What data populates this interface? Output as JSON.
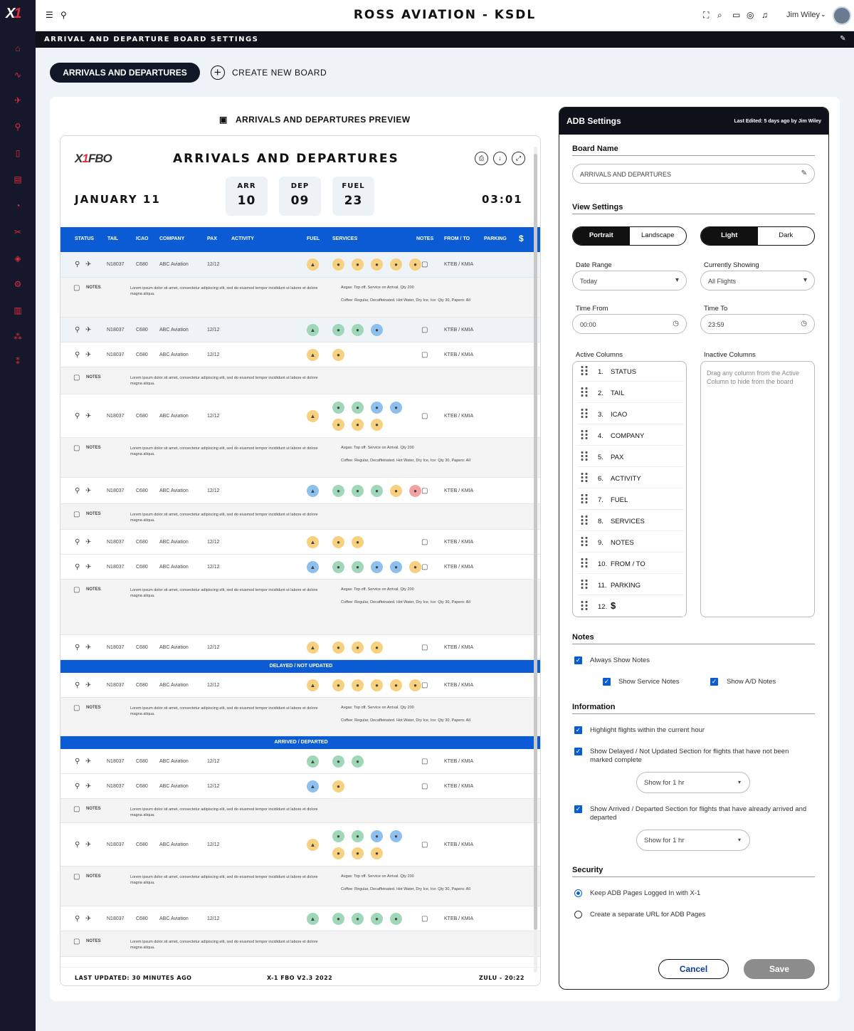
{
  "app": {
    "title": "ROSS AVIATION - KSDL",
    "user": "Jim Wiley",
    "page_title": "ARRIVAL AND DEPARTURE BOARD SETTINGS"
  },
  "actions": {
    "active_board": "ARRIVALS AND DEPARTURES",
    "create_new": "CREATE NEW BOARD"
  },
  "preview": {
    "label": "ARRIVALS AND DEPARTURES PREVIEW",
    "title": "ARRIVALS AND DEPARTURES",
    "date": "JANUARY  11",
    "counts": [
      {
        "label": "ARR",
        "value": "10"
      },
      {
        "label": "DEP",
        "value": "09"
      },
      {
        "label": "FUEL",
        "value": "23"
      }
    ],
    "clock": "03:01",
    "columns": [
      "STATUS",
      "TAIL",
      "ICAO",
      "COMPANY",
      "PAX",
      "ACTIVITY",
      "FUEL",
      "SERVICES",
      "NOTES",
      "FROM / TO",
      "PARKING",
      "$"
    ],
    "sections": {
      "delayed": "DELAYED / NOT UPDATED",
      "arrived": "ARRIVED / DEPARTED"
    },
    "note_label": "NOTES",
    "note_text": "Lorem ipsum dolor sit amet, consectetur adipiscing elit, sed do eiusmod tempor incididunt ut labore et dolore magna aliqua.",
    "svc_note_1": "Avgas: Top off. Service on Arrival. Qty 200",
    "svc_note_2": "Coffee: Regular, Decaffeinated. Hot Water, Dry Ice, Ice: Qty 30, Papers: All",
    "footer": {
      "updated": "LAST UPDATED: 30 MINUTES AGO",
      "version": "X-1 FBO V2.3 2022",
      "zulu": "ZULU - 20:22"
    },
    "row_common": {
      "tail": "N18037",
      "icao": "C680",
      "company": "ABC Aviation",
      "pax": "12/12",
      "route": "KTEB / KMIA"
    }
  },
  "settings": {
    "title": "ADB Settings",
    "last_edited": "Last Edited: 5 days ago by Jim Wiley",
    "board_name_label": "Board Name",
    "board_name_value": "ARRIVALS AND DEPARTURES",
    "view_settings_label": "View Settings",
    "orientation": [
      "Portrait",
      "Landscape"
    ],
    "theme": [
      "Light",
      "Dark"
    ],
    "date_range_label": "Date Range",
    "date_range": "Today",
    "showing_label": "Currently Showing",
    "showing": "All Flights",
    "time_from_label": "Time From",
    "time_from": "00:00",
    "time_to_label": "Time To",
    "time_to": "23:59",
    "active_label": "Active Columns",
    "inactive_label": "Inactive Columns",
    "inactive_hint": "Drag any column from the Active Column to hide from the board",
    "active_columns": [
      "STATUS",
      "TAIL",
      "ICAO",
      "COMPANY",
      "PAX",
      "ACTIVITY",
      "FUEL",
      "SERVICES",
      "NOTES",
      "FROM / TO",
      "PARKING",
      "$"
    ],
    "notes_label": "Notes",
    "always_notes": "Always Show Notes",
    "service_notes": "Show Service Notes",
    "ad_notes": "Show A/D Notes",
    "information_label": "Information",
    "highlight": "Highlight flights within the current hour",
    "delayed_opt": "Show Delayed / Not Updated Section for flights that have not been marked complete",
    "delayed_dd": "Show for 1 hr",
    "arrived_opt": "Show Arrived / Departed Section for flights that have already arrived and departed",
    "arrived_dd": "Show for 1 hr",
    "security_label": "Security",
    "sec_opt1": "Keep ADB Pages Logged In with X-1",
    "sec_opt2": "Create a separate URL for ADB Pages",
    "cancel": "Cancel",
    "save": "Save"
  }
}
